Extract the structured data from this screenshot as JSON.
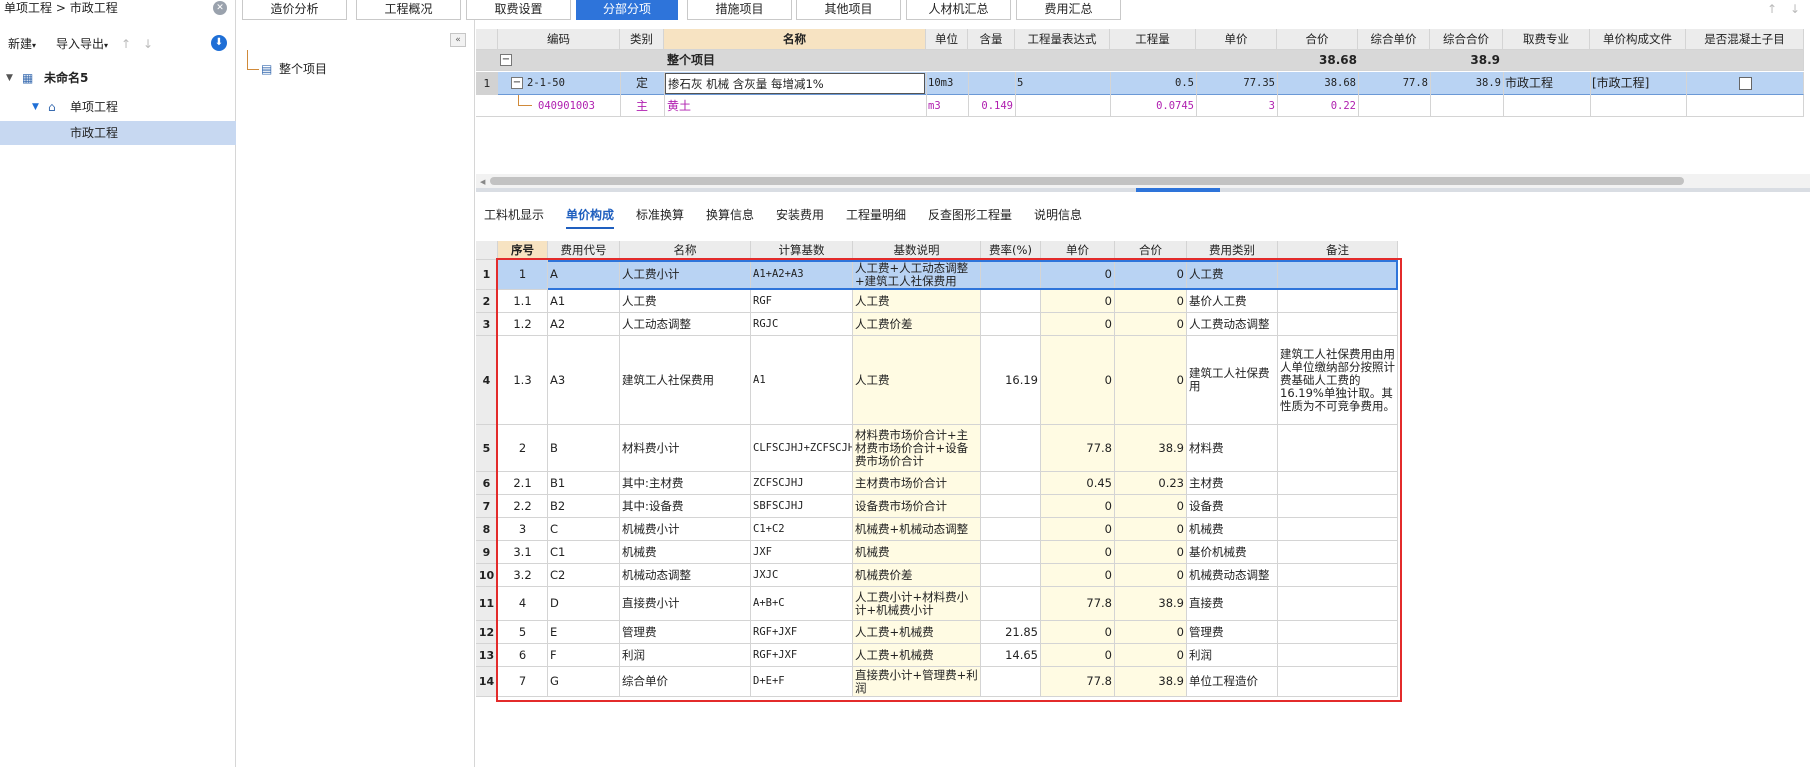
{
  "breadcrumb": {
    "part1": "单项工程",
    "sep": ">",
    "part2": "市政工程"
  },
  "left_toolbar": {
    "new_label": "新建",
    "import_export_label": "导入导出"
  },
  "tree": {
    "project": "未命名5",
    "single": "单项工程",
    "unit": "市政工程"
  },
  "middle": {
    "root_item": "整个项目"
  },
  "top_tabs": [
    "造价分析",
    "工程概况",
    "取费设置",
    "分部分项",
    "措施项目",
    "其他项目",
    "人材机汇总",
    "费用汇总"
  ],
  "upper_grid": {
    "headers": [
      "编码",
      "类别",
      "名称",
      "单位",
      "含量",
      "工程量表达式",
      "工程量",
      "单价",
      "合价",
      "综合单价",
      "综合合价",
      "取费专业",
      "单价构成文件",
      "是否混凝土子目"
    ],
    "summary": {
      "name": "整个项目",
      "total": "38.68",
      "composite_total": "38.9"
    },
    "row1": {
      "num": "1",
      "code": "2-1-50",
      "cat": "定",
      "name": "掺石灰 机械 含灰量 每增减1%",
      "unit": "10m3",
      "expr": "5",
      "qty": "0.5",
      "price": "77.35",
      "total": "38.68",
      "cprice": "77.8",
      "ctotal": "38.9",
      "major": "市政工程",
      "file": "[市政工程]"
    },
    "row2": {
      "code": "040901003",
      "cat": "主",
      "name": "黄土",
      "unit": "m3",
      "content": "0.149",
      "qty": "0.0745",
      "price": "3",
      "total": "0.22"
    }
  },
  "sub_tabs": [
    "工料机显示",
    "单价构成",
    "标准换算",
    "换算信息",
    "安装费用",
    "工程量明细",
    "反查图形工程量",
    "说明信息"
  ],
  "lower_grid": {
    "headers": [
      "序号",
      "费用代号",
      "名称",
      "计算基数",
      "基数说明",
      "费率(%)",
      "单价",
      "合价",
      "费用类别",
      "备注"
    ],
    "rows": [
      {
        "rn": "1",
        "seq": "1",
        "code": "A",
        "name": "人工费小计",
        "base": "A1+A2+A3",
        "desc": "人工费+人工动态调整+建筑工人社保费用",
        "rate": "",
        "price": "0",
        "total": "0",
        "type": "人工费",
        "note": ""
      },
      {
        "rn": "2",
        "seq": "1.1",
        "code": "A1",
        "name": "人工费",
        "base": "RGF",
        "desc": "人工费",
        "rate": "",
        "price": "0",
        "total": "0",
        "type": "基价人工费",
        "note": ""
      },
      {
        "rn": "3",
        "seq": "1.2",
        "code": "A2",
        "name": "人工动态调整",
        "base": "RGJC",
        "desc": "人工费价差",
        "rate": "",
        "price": "0",
        "total": "0",
        "type": "人工费动态调整",
        "note": ""
      },
      {
        "rn": "4",
        "seq": "1.3",
        "code": "A3",
        "name": "建筑工人社保费用",
        "base": "A1",
        "desc": "人工费",
        "rate": "16.19",
        "price": "0",
        "total": "0",
        "type": "建筑工人社保费用",
        "note": "建筑工人社保费用由用人单位缴纳部分按照计费基础人工费的16.19%单独计取。其性质为不可竞争费用。"
      },
      {
        "rn": "5",
        "seq": "2",
        "code": "B",
        "name": "材料费小计",
        "base": "CLFSCJHJ+ZCFSCJHJ+SBFSCJHJ",
        "desc": "材料费市场价合计+主材费市场价合计+设备费市场价合计",
        "rate": "",
        "price": "77.8",
        "total": "38.9",
        "type": "材料费",
        "note": ""
      },
      {
        "rn": "6",
        "seq": "2.1",
        "code": "B1",
        "name": "其中:主材费",
        "base": "ZCFSCJHJ",
        "desc": "主材费市场价合计",
        "rate": "",
        "price": "0.45",
        "total": "0.23",
        "type": "主材费",
        "note": ""
      },
      {
        "rn": "7",
        "seq": "2.2",
        "code": "B2",
        "name": "其中:设备费",
        "base": "SBFSCJHJ",
        "desc": "设备费市场价合计",
        "rate": "",
        "price": "0",
        "total": "0",
        "type": "设备费",
        "note": ""
      },
      {
        "rn": "8",
        "seq": "3",
        "code": "C",
        "name": "机械费小计",
        "base": "C1+C2",
        "desc": "机械费+机械动态调整",
        "rate": "",
        "price": "0",
        "total": "0",
        "type": "机械费",
        "note": ""
      },
      {
        "rn": "9",
        "seq": "3.1",
        "code": "C1",
        "name": "机械费",
        "base": "JXF",
        "desc": "机械费",
        "rate": "",
        "price": "0",
        "total": "0",
        "type": "基价机械费",
        "note": ""
      },
      {
        "rn": "10",
        "seq": "3.2",
        "code": "C2",
        "name": "机械动态调整",
        "base": "JXJC",
        "desc": "机械费价差",
        "rate": "",
        "price": "0",
        "total": "0",
        "type": "机械费动态调整",
        "note": ""
      },
      {
        "rn": "11",
        "seq": "4",
        "code": "D",
        "name": "直接费小计",
        "base": "A+B+C",
        "desc": "人工费小计+材料费小计+机械费小计",
        "rate": "",
        "price": "77.8",
        "total": "38.9",
        "type": "直接费",
        "note": ""
      },
      {
        "rn": "12",
        "seq": "5",
        "code": "E",
        "name": "管理费",
        "base": "RGF+JXF",
        "desc": "人工费+机械费",
        "rate": "21.85",
        "price": "0",
        "total": "0",
        "type": "管理费",
        "note": ""
      },
      {
        "rn": "13",
        "seq": "6",
        "code": "F",
        "name": "利润",
        "base": "RGF+JXF",
        "desc": "人工费+机械费",
        "rate": "14.65",
        "price": "0",
        "total": "0",
        "type": "利润",
        "note": ""
      },
      {
        "rn": "14",
        "seq": "7",
        "code": "G",
        "name": "综合单价",
        "base": "D+E+F",
        "desc": "直接费小计+管理费+利润",
        "rate": "",
        "price": "77.8",
        "total": "38.9",
        "type": "单位工程造价",
        "note": ""
      }
    ]
  },
  "colors": {
    "accent": "#2e74da",
    "highlight_border": "#e32b2b",
    "selected_row": "#b9d3f3",
    "name_header": "#f7e3c2",
    "material_text": "#b020b0"
  }
}
